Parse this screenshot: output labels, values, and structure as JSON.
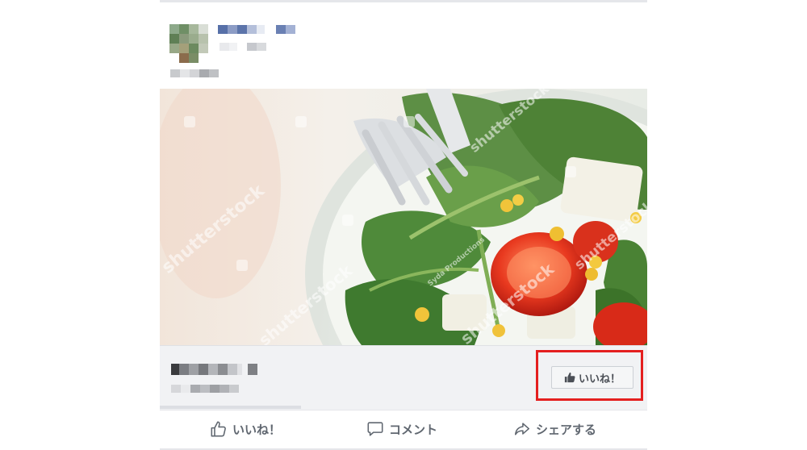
{
  "preview": {
    "like_page_label": "いいね！"
  },
  "actions": {
    "like_label": "いいね！",
    "comment_label": "コメント",
    "share_label": "シェアする"
  },
  "image": {
    "watermark_text": "shutterstock",
    "credit_text": "Syda Productions"
  },
  "colors": {
    "highlight": "#e41f1f",
    "action_text": "#606770",
    "preview_bg": "#f1f2f4"
  },
  "icons": {
    "like": "thumbs-up-icon",
    "comment": "comment-bubble-icon",
    "share": "share-arrow-icon"
  }
}
